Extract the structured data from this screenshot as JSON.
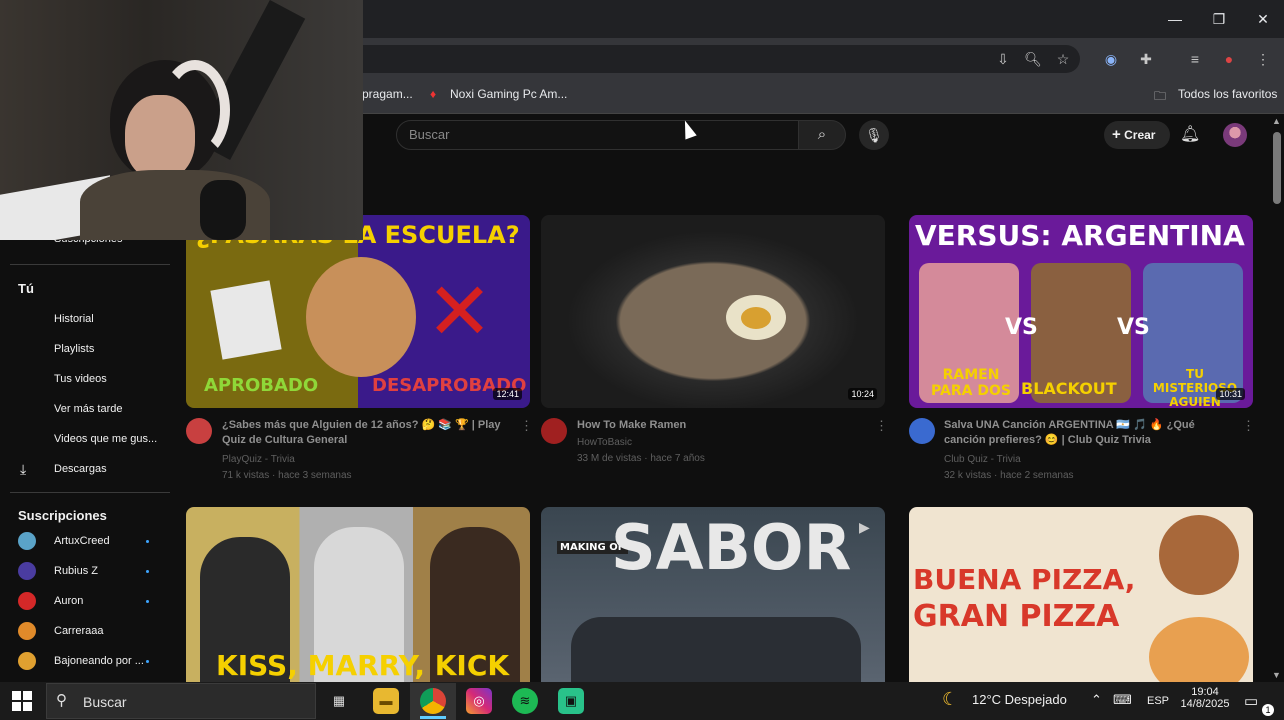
{
  "browser": {
    "bookmarks": [
      {
        "label": "pragam..."
      },
      {
        "label": "Noxi Gaming Pc Am..."
      }
    ],
    "all_bookmarks_label": "Todos los favoritos"
  },
  "header": {
    "search_placeholder": "Buscar",
    "create_label": "Crear"
  },
  "sidebar": {
    "top_item": "Suscripciones",
    "you_heading": "Tú",
    "you_items": [
      {
        "label": "Historial"
      },
      {
        "label": "Playlists"
      },
      {
        "label": "Tus videos"
      },
      {
        "label": "Ver más tarde"
      },
      {
        "label": "Videos que me gus..."
      },
      {
        "label": "Descargas"
      }
    ],
    "subs_heading": "Suscripciones",
    "subs": [
      {
        "label": "ArtuxCreed",
        "color": "#5aa3c8"
      },
      {
        "label": "Rubius Z",
        "color": "#4a3ca0"
      },
      {
        "label": "Auron",
        "color": "#d42828"
      },
      {
        "label": "Carreraaa",
        "color": "#e08a2a"
      },
      {
        "label": "Bajoneando por ...",
        "color": "#e0a030"
      }
    ]
  },
  "videos": [
    {
      "title_line1": "¿Sabes más que Alguien de 12 años? 🤔 📚 🏆 | Play",
      "title_line2": "Quiz de Cultura General",
      "channel": "PlayQuiz - Trivia",
      "meta": "71 k vistas · hace 3 semanas",
      "duration": "12:41",
      "thumb_text_top": "¿PASARÁS LA ESCUELA?",
      "thumb_text_left": "APROBADO",
      "thumb_text_right": "DESAPROBADO"
    },
    {
      "title_line1": "How To Make Ramen",
      "title_line2": "",
      "channel": "HowToBasic",
      "meta": "33 M de vistas · hace 7 años",
      "duration": "10:24"
    },
    {
      "title_line1": "Salva UNA Canción ARGENTINA 🇦🇷 🎵 🔥 ¿Qué",
      "title_line2": "canción prefieres? 😊 | Club Quiz Trivia",
      "channel": "Club Quiz - Trivia",
      "meta": "32 k vistas · hace 2 semanas",
      "duration": "10:31",
      "thumb_text_top": "VERSUS: ARGENTINA",
      "thumb_text_a": "RAMEN PARA DOS",
      "thumb_text_b": "BLACKOUT",
      "thumb_text_c": "TU MISTERIOSO AGUIEN",
      "thumb_vs": "VS"
    },
    {
      "thumb_text": "KISS, MARRY, KICK"
    },
    {
      "thumb_text": "SABOR",
      "thumb_badge": "MAKING OF"
    },
    {
      "thumb_text_1": "BUENA PIZZA,",
      "thumb_text_2": "GRAN PIZZA"
    }
  ],
  "taskbar": {
    "search_label": "Buscar",
    "weather": "12°C  Despejado",
    "language": "ESP",
    "time": "19:04",
    "date": "14/8/2025",
    "notif_count": "1"
  }
}
